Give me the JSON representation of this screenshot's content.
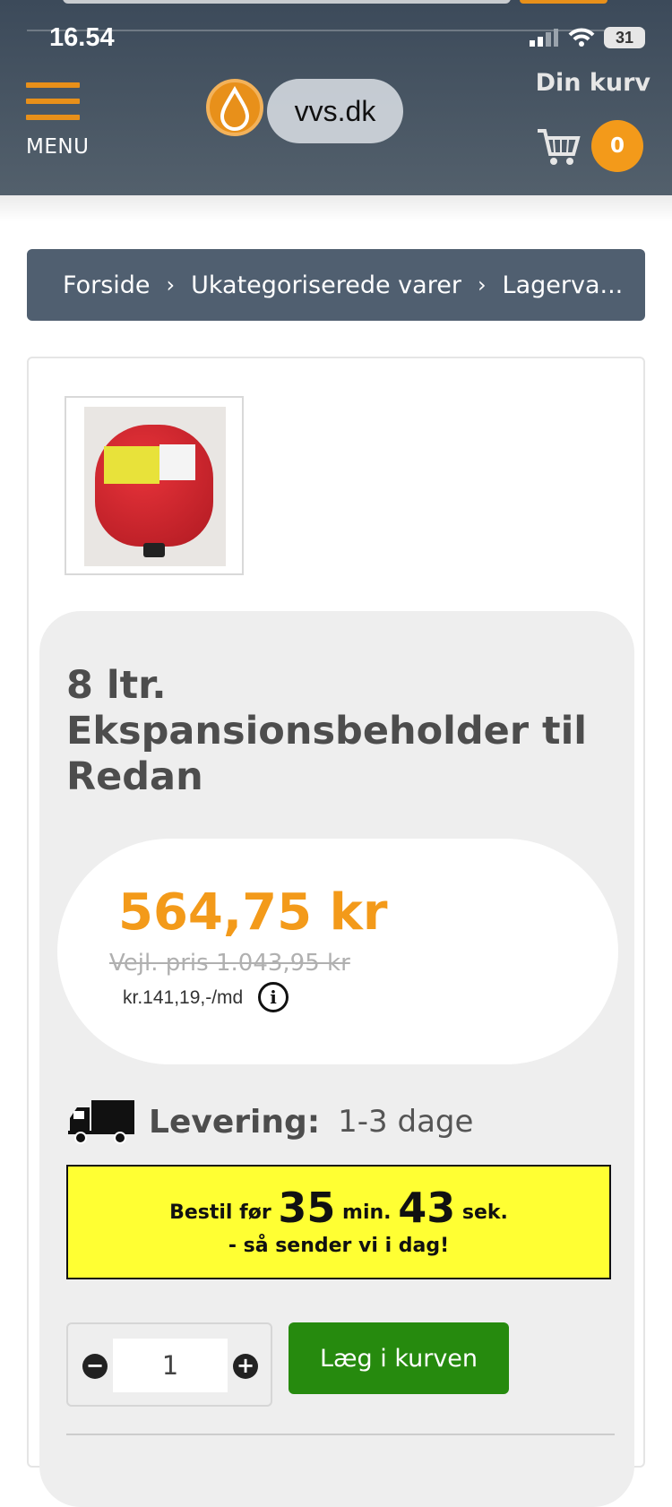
{
  "status_bar": {
    "time": "16.54",
    "battery": "31"
  },
  "header": {
    "menu_label": "MENU",
    "logo_text": "vvs.dk",
    "cart_label": "Din kurv",
    "cart_count": "0",
    "accent_color": "#e8901a",
    "background_color": "#3f4c5c"
  },
  "breadcrumb": {
    "items": [
      "Forside",
      "Ukategoriserede varer",
      "Lagerva..."
    ],
    "separator": "›"
  },
  "product": {
    "title": "8 ltr. Ekspansionsbeholder til Redan",
    "price": "564,75 kr",
    "old_price": "Vejl. pris 1.043,95 kr",
    "monthly": "kr.141,19,-/md",
    "info_icon": "i",
    "price_color": "#f39a1a"
  },
  "delivery": {
    "label": "Levering:",
    "value": "1-3 dage"
  },
  "countdown": {
    "prefix": "Bestil før",
    "minutes": "35",
    "min_label": "min.",
    "seconds": "43",
    "sec_label": "sek.",
    "line2": "- så sender vi i dag!"
  },
  "purchase": {
    "quantity": "1",
    "minus": "−",
    "plus": "+",
    "add_label": "Læg i kurven",
    "button_color": "#268a0e"
  }
}
